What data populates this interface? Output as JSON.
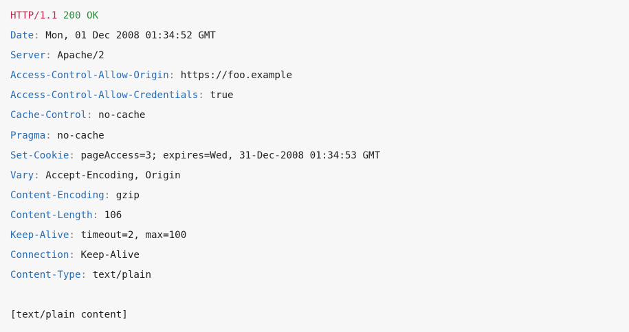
{
  "status_line": {
    "protocol": "HTTP/1.1",
    "status": "200 OK"
  },
  "headers": [
    {
      "name": "Date",
      "value": "Mon, 01 Dec 2008 01:34:52 GMT"
    },
    {
      "name": "Server",
      "value": "Apache/2"
    },
    {
      "name": "Access-Control-Allow-Origin",
      "value": "https://foo.example"
    },
    {
      "name": "Access-Control-Allow-Credentials",
      "value": "true"
    },
    {
      "name": "Cache-Control",
      "value": "no-cache"
    },
    {
      "name": "Pragma",
      "value": "no-cache"
    },
    {
      "name": "Set-Cookie",
      "value": "pageAccess=3; expires=Wed, 31-Dec-2008 01:34:53 GMT"
    },
    {
      "name": "Vary",
      "value": "Accept-Encoding, Origin"
    },
    {
      "name": "Content-Encoding",
      "value": "gzip"
    },
    {
      "name": "Content-Length",
      "value": "106"
    },
    {
      "name": "Keep-Alive",
      "value": "timeout=2, max=100"
    },
    {
      "name": "Connection",
      "value": "Keep-Alive"
    },
    {
      "name": "Content-Type",
      "value": "text/plain"
    }
  ],
  "separator": ":",
  "body": "[text/plain content]",
  "colors": {
    "background": "#f7f7f7",
    "protocol": "#c7254e",
    "status": "#2e8b3e",
    "header_name": "#2a6cb4",
    "text": "#1f1f1f"
  }
}
